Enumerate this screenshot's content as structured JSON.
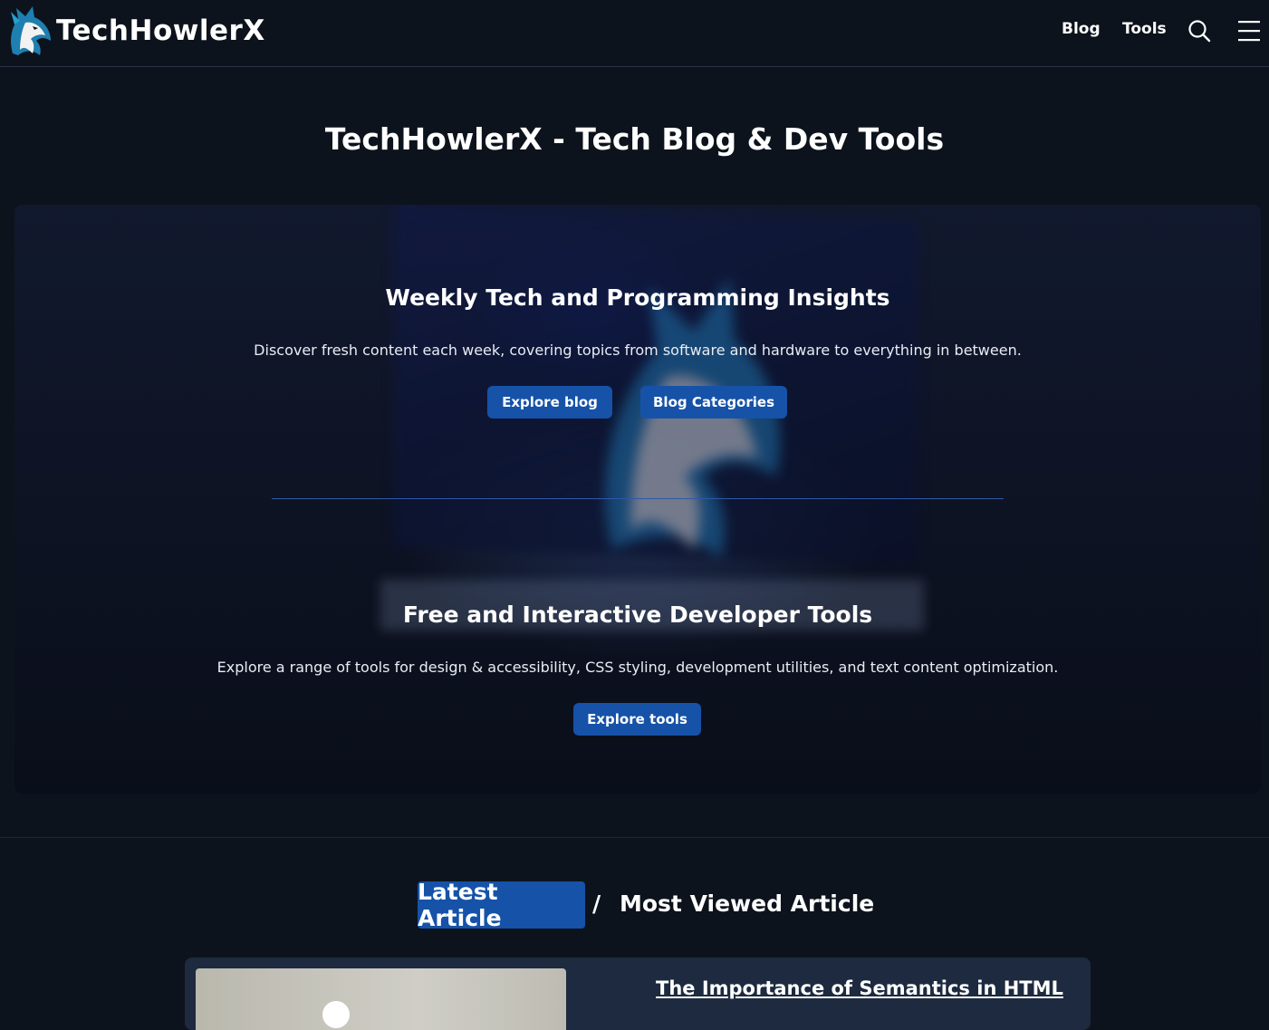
{
  "header": {
    "brand": "TechHowlerX",
    "nav": [
      {
        "label": "Blog"
      },
      {
        "label": "Tools"
      }
    ],
    "icons": [
      "wolf-logo-icon",
      "search-icon",
      "hamburger-menu-icon"
    ]
  },
  "page_title": "TechHowlerX - Tech Blog & Dev Tools",
  "hero": {
    "blog": {
      "title": "Weekly Tech and Programming Insights",
      "description": "Discover fresh content each week, covering topics from software and hardware to everything in between.",
      "buttons": [
        "Explore blog",
        "Blog Categories"
      ]
    },
    "tools": {
      "title": "Free and Interactive Developer Tools",
      "description": "Explore a range of tools for design & accessibility, CSS styling, development utilities, and text content optimization.",
      "button": "Explore tools"
    }
  },
  "articles": {
    "tab_latest": "Latest Article",
    "separator": "/",
    "tab_most_viewed": "Most Viewed Article",
    "featured": {
      "title": "The Importance of Semantics in HTML"
    }
  },
  "colors": {
    "background": "#0d131c",
    "accent": "#1652a8",
    "card": "#1d2a3f"
  }
}
